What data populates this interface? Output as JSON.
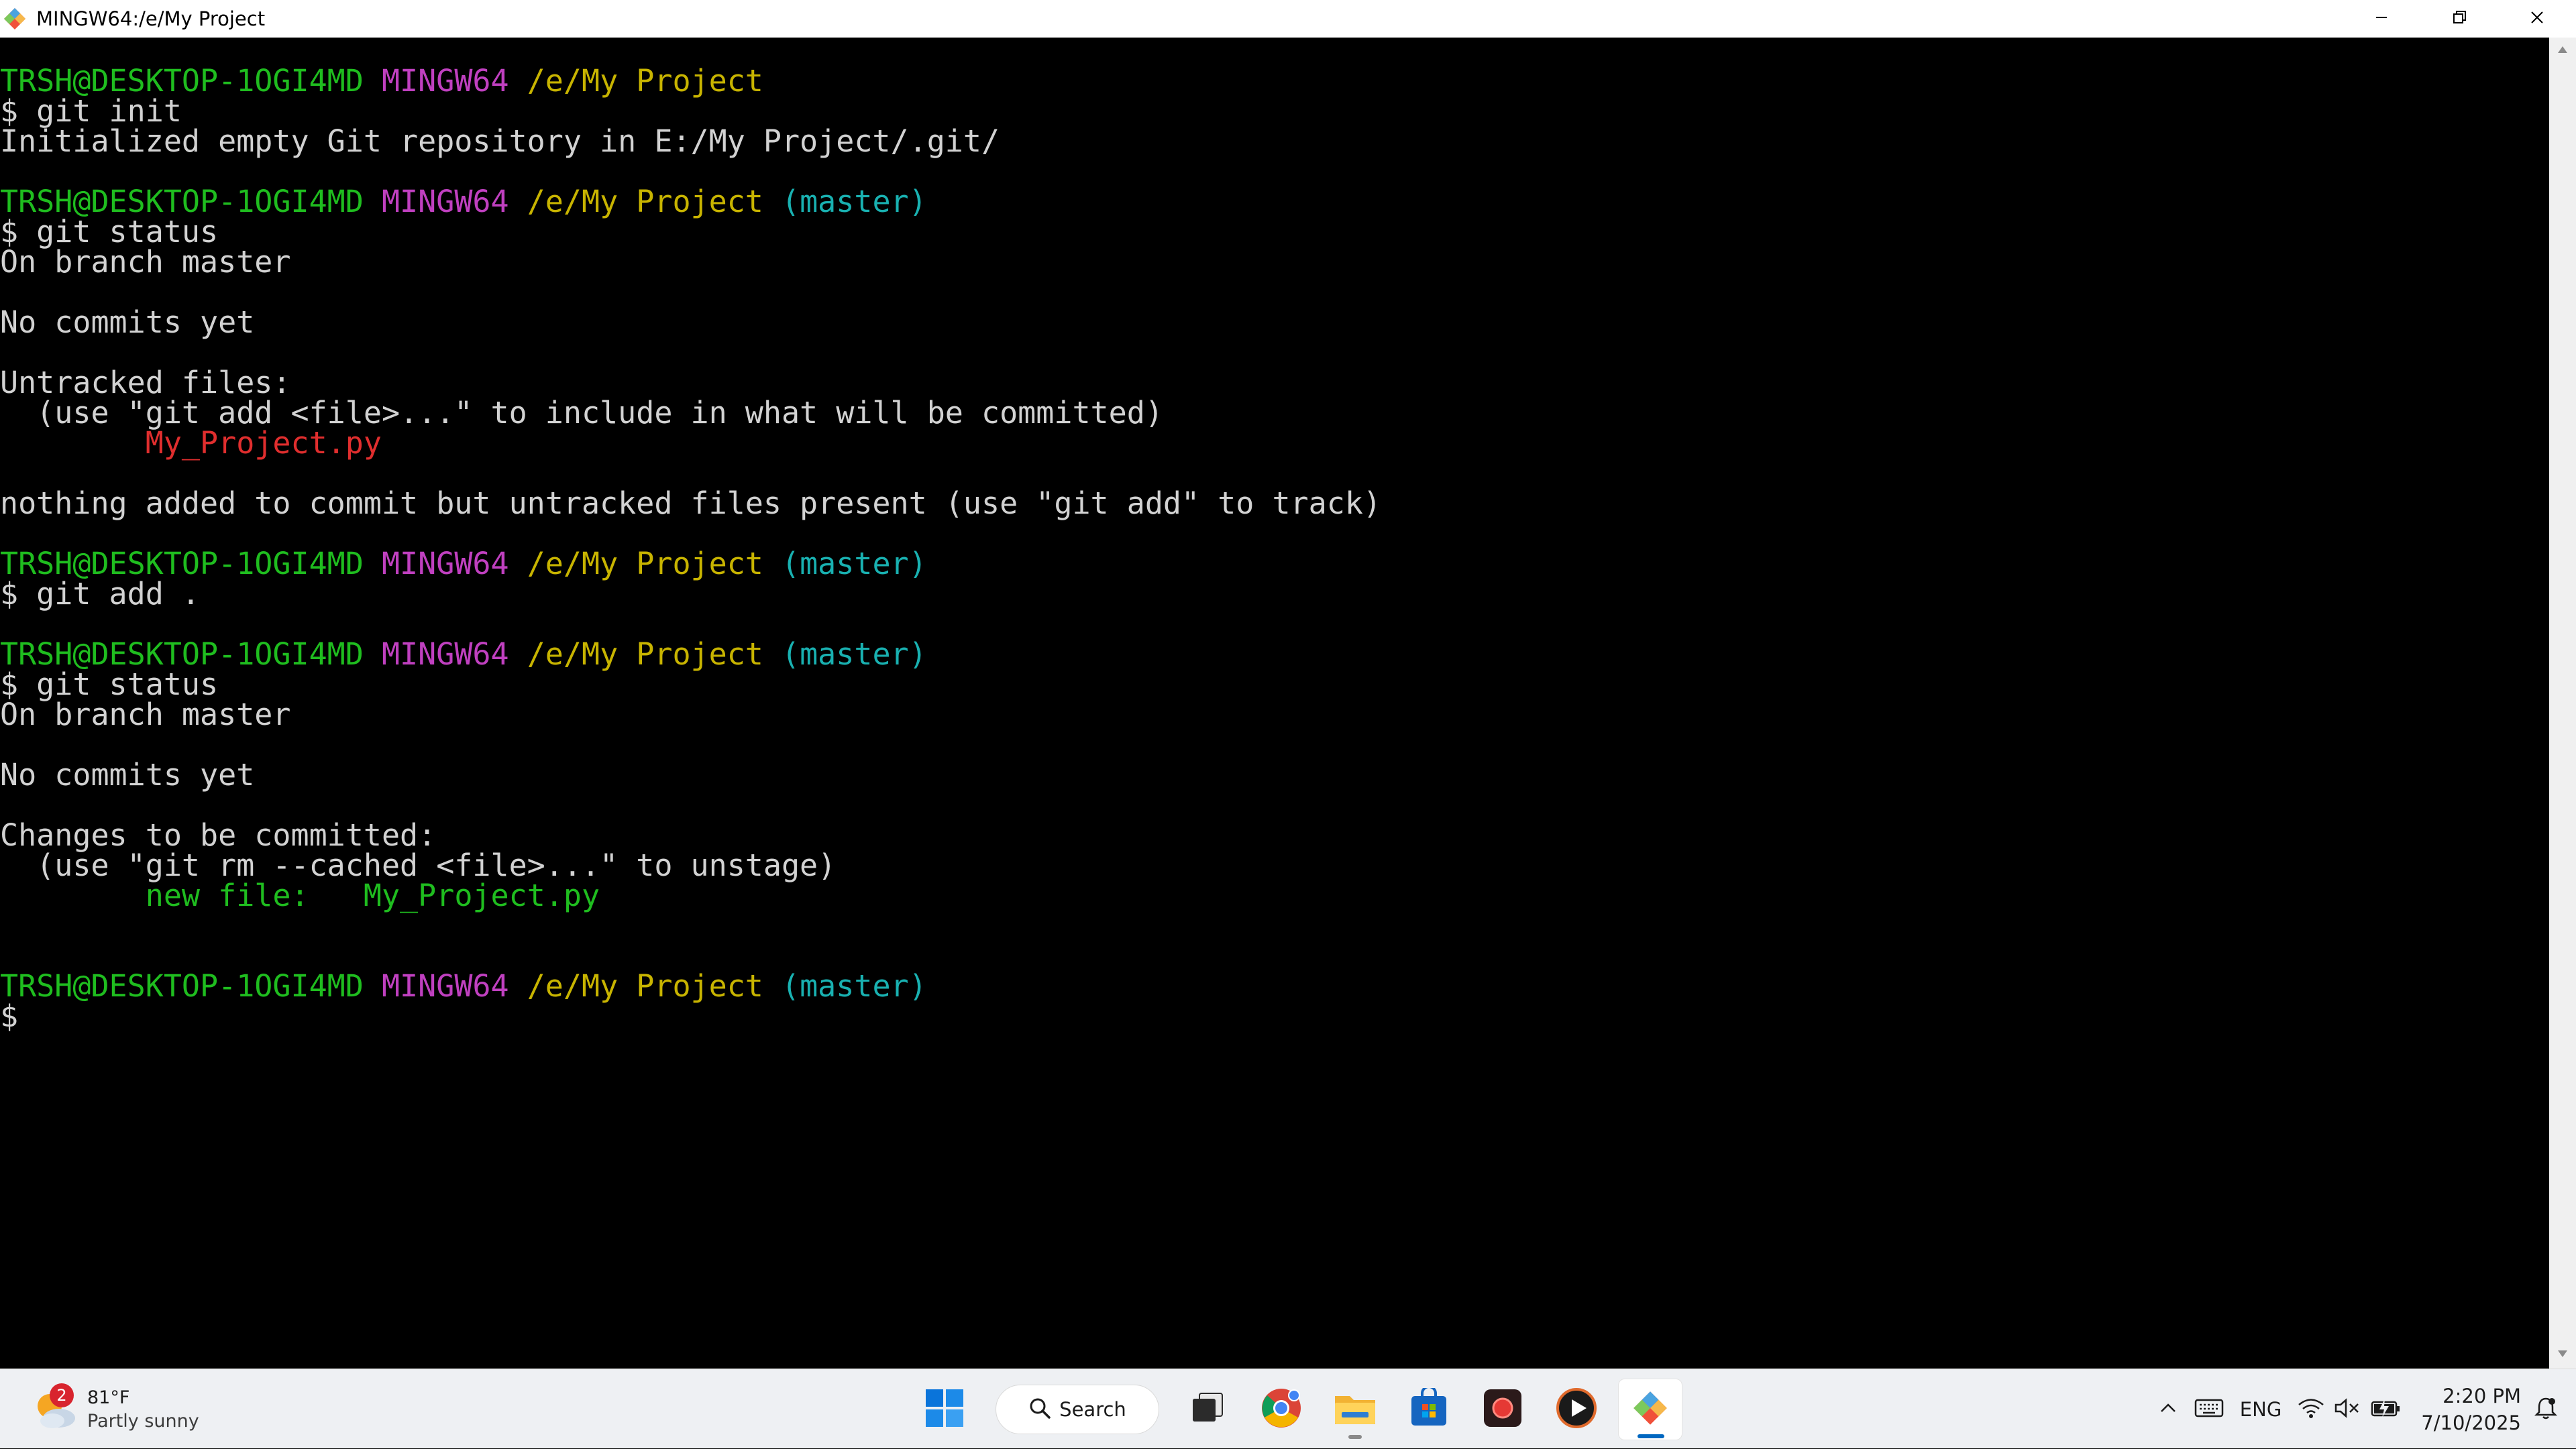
{
  "window": {
    "title": "MINGW64:/e/My Project",
    "icon": "git-bash-icon",
    "controls": [
      "minimize-icon",
      "restore-icon",
      "close-icon"
    ]
  },
  "terminal": {
    "colors": {
      "green": "#1fbd1f",
      "magenta": "#c040c0",
      "yellow": "#c8b400",
      "cyan": "#19b1b1",
      "red": "#e02e2e",
      "text": "#d2d2d2",
      "background": "#000000"
    },
    "lines": [
      [
        {
          "t": "TRSH@DESKTOP-1OGI4MD",
          "c": "green"
        },
        {
          "t": " "
        },
        {
          "t": "MINGW64",
          "c": "magenta"
        },
        {
          "t": " "
        },
        {
          "t": "/e/My Project",
          "c": "yellow"
        }
      ],
      [
        {
          "t": "$ git init"
        }
      ],
      [
        {
          "t": "Initialized empty Git repository in E:/My Project/.git/"
        }
      ],
      [],
      [
        {
          "t": "TRSH@DESKTOP-1OGI4MD",
          "c": "green"
        },
        {
          "t": " "
        },
        {
          "t": "MINGW64",
          "c": "magenta"
        },
        {
          "t": " "
        },
        {
          "t": "/e/My Project",
          "c": "yellow"
        },
        {
          "t": " "
        },
        {
          "t": "(master)",
          "c": "cyan"
        }
      ],
      [
        {
          "t": "$ git status"
        }
      ],
      [
        {
          "t": "On branch master"
        }
      ],
      [],
      [
        {
          "t": "No commits yet"
        }
      ],
      [],
      [
        {
          "t": "Untracked files:"
        }
      ],
      [
        {
          "t": "  (use \"git add <file>...\" to include in what will be committed)"
        }
      ],
      [
        {
          "t": "        "
        },
        {
          "t": "My_Project.py",
          "c": "red"
        }
      ],
      [],
      [
        {
          "t": "nothing added to commit but untracked files present (use \"git add\" to track)"
        }
      ],
      [],
      [
        {
          "t": "TRSH@DESKTOP-1OGI4MD",
          "c": "green"
        },
        {
          "t": " "
        },
        {
          "t": "MINGW64",
          "c": "magenta"
        },
        {
          "t": " "
        },
        {
          "t": "/e/My Project",
          "c": "yellow"
        },
        {
          "t": " "
        },
        {
          "t": "(master)",
          "c": "cyan"
        }
      ],
      [
        {
          "t": "$ git add ."
        }
      ],
      [],
      [
        {
          "t": "TRSH@DESKTOP-1OGI4MD",
          "c": "green"
        },
        {
          "t": " "
        },
        {
          "t": "MINGW64",
          "c": "magenta"
        },
        {
          "t": " "
        },
        {
          "t": "/e/My Project",
          "c": "yellow"
        },
        {
          "t": " "
        },
        {
          "t": "(master)",
          "c": "cyan"
        }
      ],
      [
        {
          "t": "$ git status"
        }
      ],
      [
        {
          "t": "On branch master"
        }
      ],
      [],
      [
        {
          "t": "No commits yet"
        }
      ],
      [],
      [
        {
          "t": "Changes to be committed:"
        }
      ],
      [
        {
          "t": "  (use \"git rm --cached <file>...\" to unstage)"
        }
      ],
      [
        {
          "t": "        "
        },
        {
          "t": "new file:   My_Project.py",
          "c": "green"
        }
      ],
      [],
      [],
      [
        {
          "t": "TRSH@DESKTOP-1OGI4MD",
          "c": "green"
        },
        {
          "t": " "
        },
        {
          "t": "MINGW64",
          "c": "magenta"
        },
        {
          "t": " "
        },
        {
          "t": "/e/My Project",
          "c": "yellow"
        },
        {
          "t": " "
        },
        {
          "t": "(master)",
          "c": "cyan"
        }
      ],
      [
        {
          "t": "$"
        }
      ]
    ]
  },
  "taskbar": {
    "weather": {
      "badge": "2",
      "temperature": "81°F",
      "description": "Partly sunny",
      "icon": "partly-sunny-icon"
    },
    "search_label": "Search",
    "apps": [
      {
        "name": "start-button",
        "icon": "windows-logo-icon"
      },
      {
        "name": "task-view-button",
        "icon": "task-view-icon"
      },
      {
        "name": "chrome-app",
        "icon": "chrome-icon"
      },
      {
        "name": "file-explorer-app",
        "icon": "folder-icon"
      },
      {
        "name": "microsoft-store-app",
        "icon": "store-icon"
      },
      {
        "name": "recorder-app",
        "icon": "record-icon"
      },
      {
        "name": "media-player-app",
        "icon": "play-icon"
      },
      {
        "name": "git-bash-app",
        "icon": "git-bash-icon"
      }
    ],
    "tray": {
      "language": "ENG",
      "time": "2:20 PM",
      "date": "7/10/2025",
      "icons": [
        "chevron-up-icon",
        "keyboard-icon",
        "wifi-icon",
        "speaker-muted-icon",
        "battery-charging-icon",
        "notification-bell-icon"
      ]
    }
  }
}
